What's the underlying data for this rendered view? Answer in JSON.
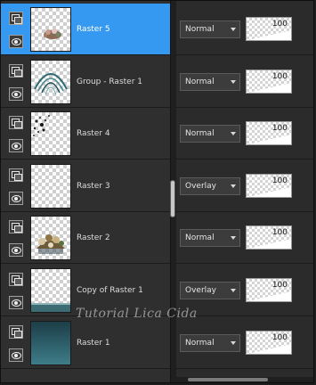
{
  "layers": [
    {
      "name": "Raster 5",
      "selected": true,
      "blend_mode": "Normal",
      "opacity": "100",
      "thumbnail": "flowers-small"
    },
    {
      "name": "Group - Raster 1",
      "selected": false,
      "blend_mode": "Normal",
      "opacity": "100",
      "thumbnail": "teal-arcs"
    },
    {
      "name": "Raster 4",
      "selected": false,
      "blend_mode": "Normal",
      "opacity": "100",
      "thumbnail": "dark-sparkles"
    },
    {
      "name": "Raster 3",
      "selected": false,
      "blend_mode": "Overlay",
      "opacity": "100",
      "thumbnail": "empty"
    },
    {
      "name": "Raster 2",
      "selected": false,
      "blend_mode": "Normal",
      "opacity": "100",
      "thumbnail": "flowers-large"
    },
    {
      "name": "Copy of Raster 1",
      "selected": false,
      "blend_mode": "Overlay",
      "opacity": "100",
      "thumbnail": "bottom-strip"
    },
    {
      "name": "Raster 1",
      "selected": false,
      "blend_mode": "Normal",
      "opacity": "100",
      "thumbnail": "teal-gradient"
    }
  ],
  "watermark": "Tutorial Lica Cida",
  "colors": {
    "selection": "#3599f2",
    "panel_bg": "#2f2f2f",
    "teal": "#2d5e6b"
  }
}
